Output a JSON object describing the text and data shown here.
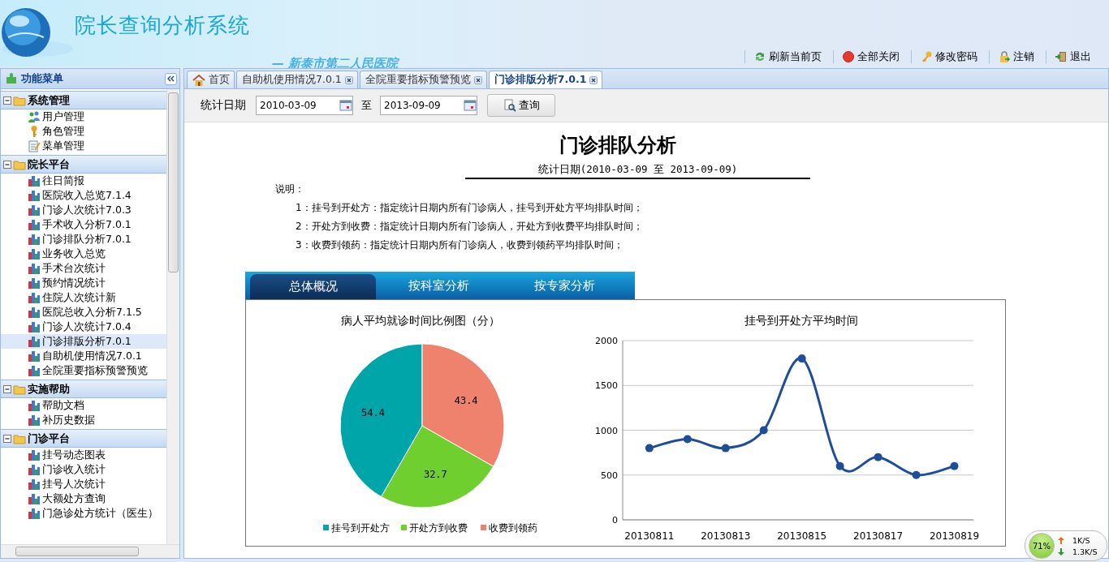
{
  "header": {
    "title": "院长查询分析系统",
    "subtitle": "— 新泰市第二人民医院"
  },
  "toolbar": [
    {
      "label": "刷新当前页",
      "kind": "refresh"
    },
    {
      "label": "全部关闭",
      "kind": "stop"
    },
    {
      "label": "修改密码",
      "kind": "key"
    },
    {
      "label": "注销",
      "kind": "lock"
    },
    {
      "label": "退出",
      "kind": "exit"
    }
  ],
  "sidebar": {
    "title": "功能菜单",
    "groups": [
      {
        "label": "系统管理",
        "expanded": true,
        "items": [
          {
            "label": "用户管理",
            "kind": "user",
            "selected": false
          },
          {
            "label": "角色管理",
            "kind": "key",
            "selected": false
          },
          {
            "label": "菜单管理",
            "kind": "edit",
            "selected": false
          }
        ]
      },
      {
        "label": "院长平台",
        "expanded": true,
        "items": [
          {
            "label": "往日简报",
            "kind": "chart",
            "selected": false
          },
          {
            "label": "医院收入总览7.1.4",
            "kind": "chart",
            "selected": false
          },
          {
            "label": "门诊人次统计7.0.3",
            "kind": "chart",
            "selected": false
          },
          {
            "label": "手术收入分析7.0.1",
            "kind": "chart",
            "selected": false
          },
          {
            "label": "门诊排队分析7.0.1",
            "kind": "chart",
            "selected": false
          },
          {
            "label": "业务收入总览",
            "kind": "chart",
            "selected": false
          },
          {
            "label": "手术台次统计",
            "kind": "chart",
            "selected": false
          },
          {
            "label": "预约情况统计",
            "kind": "chart",
            "selected": false
          },
          {
            "label": "住院人次统计新",
            "kind": "chart",
            "selected": false
          },
          {
            "label": "医院总收入分析7.1.5",
            "kind": "chart",
            "selected": false
          },
          {
            "label": "门诊人次统计7.0.4",
            "kind": "chart",
            "selected": false
          },
          {
            "label": "门诊排版分析7.0.1",
            "kind": "chart",
            "selected": true
          },
          {
            "label": "自助机使用情况7.0.1",
            "kind": "chart",
            "selected": false
          },
          {
            "label": "全院重要指标预警预览",
            "kind": "chart",
            "selected": false
          }
        ]
      },
      {
        "label": "实施帮助",
        "expanded": true,
        "items": [
          {
            "label": "帮助文档",
            "kind": "chart",
            "selected": false
          },
          {
            "label": "补历史数据",
            "kind": "chart",
            "selected": false
          }
        ]
      },
      {
        "label": "门诊平台",
        "expanded": true,
        "items": [
          {
            "label": "挂号动态图表",
            "kind": "chart",
            "selected": false
          },
          {
            "label": "门诊收入统计",
            "kind": "chart",
            "selected": false
          },
          {
            "label": "挂号人次统计",
            "kind": "chart",
            "selected": false
          },
          {
            "label": "大额处方查询",
            "kind": "chart",
            "selected": false
          },
          {
            "label": "门急诊处方统计（医生）",
            "kind": "chart",
            "selected": false
          }
        ]
      }
    ]
  },
  "tabs": [
    {
      "label": "首页",
      "kind": "home",
      "selected": false
    },
    {
      "label": "自助机使用情况7.0.1",
      "kind": "closable",
      "selected": false
    },
    {
      "label": "全院重要指标预警预览",
      "kind": "closable",
      "selected": false
    },
    {
      "label": "门诊排版分析7.0.1",
      "kind": "closable",
      "selected": true
    }
  ],
  "query": {
    "label": "统计日期",
    "from": "2010-03-09",
    "separator": "至",
    "to": "2013-09-09",
    "button": "查询"
  },
  "report": {
    "title": "门诊排队分析",
    "date_range": "统计日期(2010-03-09 至 2013-09-09)",
    "notes_heading": "说明：",
    "notes": [
      "1：挂号到开处方：指定统计日期内所有门诊病人，挂号到开处方平均排队时间；",
      "2：开处方到收费：指定统计日期内所有门诊病人，开处方到收费平均排队时间；",
      "3：收费到领药：指定统计日期内所有门诊病人，收费到领药平均排队时间；"
    ]
  },
  "chart_tabs": [
    {
      "label": "总体概况",
      "selected": true
    },
    {
      "label": "按科室分析",
      "selected": false
    },
    {
      "label": "按专家分析",
      "selected": false
    }
  ],
  "pie_chart": {
    "chart_data": {
      "type": "pie",
      "title": "病人平均就诊时间比例图（分）",
      "categories": [
        "挂号到开处方",
        "开处方到收费",
        "收费到领药"
      ],
      "values": [
        54.4,
        32.7,
        43.4
      ],
      "colors": [
        "#00a5aa",
        "#6ecf2e",
        "#ee826d"
      ],
      "data_labels": true,
      "legend": "bottom"
    }
  },
  "line_chart": {
    "chart_data": {
      "type": "line",
      "title": "挂号到开处方平均时间",
      "x": [
        20130811,
        20130812,
        20130813,
        20130814,
        20130815,
        20130816,
        20130817,
        20130818,
        20130819
      ],
      "xticks": [
        20130811,
        20130813,
        20130815,
        20130817,
        20130819
      ],
      "xlim": [
        20130810.3,
        20130819.5
      ],
      "ylim": [
        0,
        2000
      ],
      "yticks": [
        0,
        500,
        1000,
        1500,
        2000
      ],
      "grid": true,
      "series": [
        {
          "color": "#1f4e99",
          "marker": "circle",
          "values": [
            800,
            900,
            800,
            1000,
            1800,
            600,
            700,
            500,
            600
          ]
        }
      ]
    }
  },
  "network_monitor": {
    "usage": "71%",
    "upload": "1K/S",
    "download": "1.3K/S"
  }
}
